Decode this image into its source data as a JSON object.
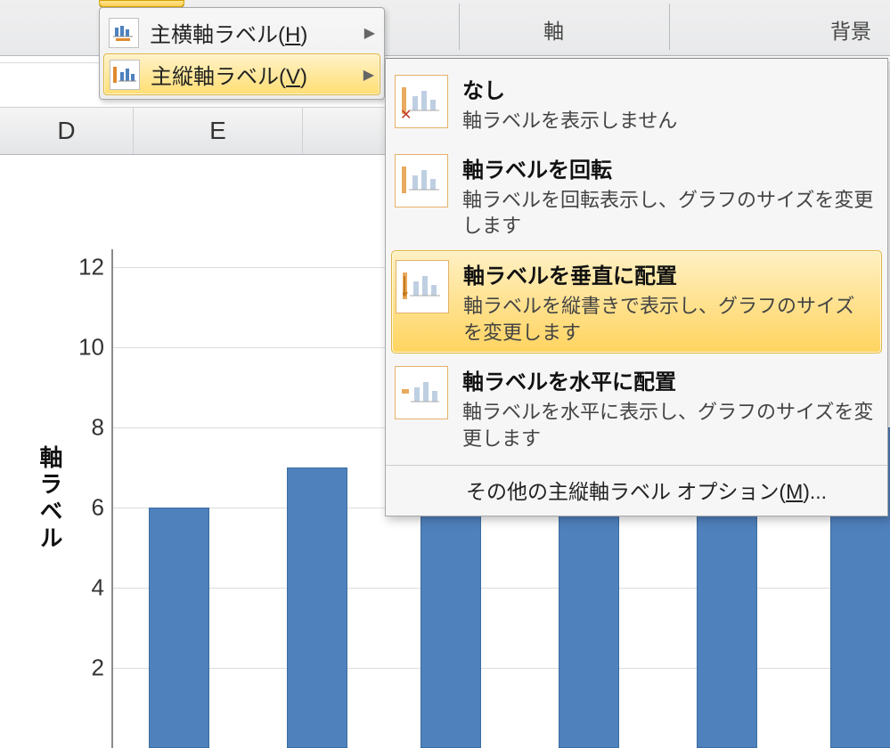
{
  "ribbon": {
    "group_axis": "軸",
    "group_bg": "背景"
  },
  "columns": {
    "D": "D",
    "E": "E"
  },
  "menu1": {
    "horiz_pre": "主横軸ラベル(",
    "horiz_key": "H",
    "horiz_post": ")",
    "vert_pre": "主縦軸ラベル(",
    "vert_key": "V",
    "vert_post": ")"
  },
  "menu2": {
    "none_t": "なし",
    "none_d": "軸ラベルを表示しません",
    "rot_t": "軸ラベルを回転",
    "rot_d": "軸ラベルを回転表示し、グラフのサイズを変更します",
    "vert_t": "軸ラベルを垂直に配置",
    "vert_d": "軸ラベルを縦書きで表示し、グラフのサイズを変更します",
    "horz_t": "軸ラベルを水平に配置",
    "horz_d": "軸ラベルを水平に表示し、グラフのサイズを変更します",
    "more_pre": "その他の主縦軸ラベル オプション(",
    "more_key": "M",
    "more_post": ")..."
  },
  "chart_data": {
    "type": "bar",
    "ylabel": "軸ラベル",
    "ylim": [
      0,
      12
    ],
    "yticks": [
      2,
      4,
      6,
      8,
      10,
      12
    ],
    "values": [
      6,
      7,
      10,
      8,
      11,
      8
    ]
  }
}
